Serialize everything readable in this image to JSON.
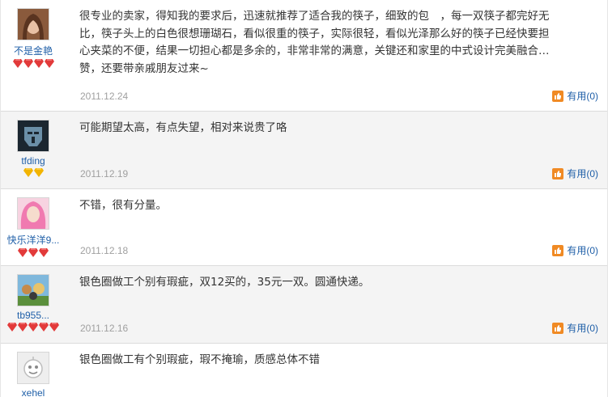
{
  "reviews": [
    {
      "user": "不是金艳",
      "avatar": "portrait-woman-avatar",
      "rank_icon": "red-diamond-icon",
      "rank_count": 4,
      "content": "很专业的卖家，得知我的要求后，迅速就推荐了适合我的筷子，细致的包　，每一双筷子都完好无比，筷子头上的白色很想珊瑚石，看似很重的筷子，实际很轻，看似光泽那么好的筷子已经快要担心夹菜的不便，结果一切担心都是多余的，非常非常的满意，关键还和家里的中式设计完美融合…赞，还要带亲戚朋友过来~",
      "date": "2011.12.24",
      "helpful": "有用(0)"
    },
    {
      "user": "tfding",
      "avatar": "robot-mask-avatar",
      "rank_icon": "yellow-diamond-icon",
      "rank_count": 2,
      "content": "可能期望太高，有点失望，相对来说贵了咯",
      "date": "2011.12.19",
      "helpful": "有用(0)"
    },
    {
      "user": "快乐洋洋9...",
      "avatar": "pink-hair-avatar",
      "rank_icon": "red-diamond-icon",
      "rank_count": 3,
      "content": "不错，很有分量。",
      "date": "2011.12.18",
      "helpful": "有用(0)"
    },
    {
      "user": "tb955...",
      "avatar": "cartoon-group-avatar",
      "rank_icon": "red-diamond-icon",
      "rank_count": 5,
      "content": "银色圈做工个别有瑕疵，双12买的，35元一双。圆通快递。",
      "date": "2011.12.16",
      "helpful": "有用(0)"
    },
    {
      "user": "xehel",
      "avatar": "default-user-avatar",
      "rank_icon": "red-diamond-icon",
      "rank_count": 0,
      "content": "银色圈做工有个别瑕疵，瑕不掩瑜，质感总体不错",
      "date": "",
      "helpful": ""
    }
  ],
  "colors": {
    "link": "#1f5fa8",
    "date": "#a0a0a0",
    "alt_row": "#f4f4f4",
    "thumb": "#f08a24",
    "rank_red": "#e23a3a",
    "rank_yellow": "#f2b400"
  }
}
